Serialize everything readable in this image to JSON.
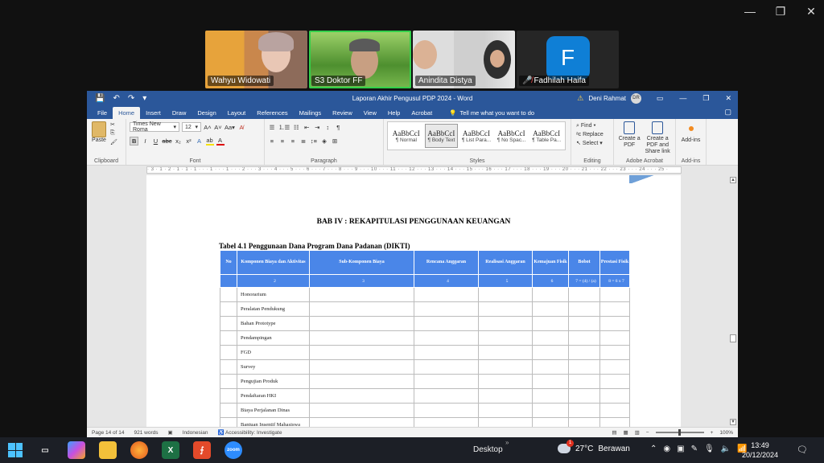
{
  "zoom_window": {
    "minimize": "—",
    "restore": "❐",
    "close": "✕"
  },
  "participants": [
    {
      "name": "Wahyu Widowati",
      "muted": false
    },
    {
      "name": "S3 Doktor FF",
      "muted": false
    },
    {
      "name": "Anindita Distya",
      "muted": false
    },
    {
      "name": "Fadhilah Haifa",
      "muted": true,
      "avatar_letter": "F"
    }
  ],
  "word": {
    "title": "Laporan Akhir Pengusul PDP 2024  -  Word",
    "user_name": "Deni Rahmat",
    "user_initials": "DR",
    "tabs": [
      "File",
      "Home",
      "Insert",
      "Draw",
      "Design",
      "Layout",
      "References",
      "Mailings",
      "Review",
      "View",
      "Help",
      "Acrobat"
    ],
    "tell_me": "Tell me what you want to do",
    "ribbon": {
      "clipboard": {
        "paste": "Paste",
        "label": "Clipboard"
      },
      "font": {
        "name": "Times New Roma",
        "size": "12",
        "label": "Font"
      },
      "paragraph": {
        "label": "Paragraph"
      },
      "styles": {
        "label": "Styles",
        "items": [
          {
            "sample": "AaBbCcI",
            "name": "¶ Normal"
          },
          {
            "sample": "AaBbCcI",
            "name": "¶ Body Text"
          },
          {
            "sample": "AaBbCcI",
            "name": "¶ List Para..."
          },
          {
            "sample": "AaBbCcI",
            "name": "¶ No Spac..."
          },
          {
            "sample": "AaBbCcI",
            "name": "¶ Table Pa..."
          }
        ]
      },
      "editing": {
        "find": "Find",
        "replace": "Replace",
        "select": "Select",
        "label": "Editing"
      },
      "acrobat": {
        "create_pdf": "Create a PDF",
        "create_share": "Create a PDF and Share link",
        "label": "Adobe Acrobat"
      },
      "addins": {
        "button": "Add-ins",
        "label": "Add-ins"
      }
    },
    "ruler_text": "· 3 · 1 · 2 · 1 · 1 · 1 · · · 1 · · · 1 · · · 2 · · · 3 · · · 4 · · · 5 · · · 6 · · · 7 · · · 8 · · · 9 · · · 10 · · · 11 · · · 12 · · · 13 · · · 14 · · · 15 · · · 16 · · · 17 · · · 18 · · · 19 · · · 20 · · · 21 · · · 22 · · · 23 · · · 24 · · · 25 ·",
    "document": {
      "heading": "BAB IV : REKAPITULASI PENGGUNAAN KEUANGAN",
      "table_caption": "Tabel 4.1 Penggunaan Dana Program Dana Padanan (DIKTI)",
      "table_headers": [
        "No",
        "Komponen Biaya dan Aktivitas",
        "Sub-Komponen Biaya",
        "Rencana Anggaran",
        "Realisasi Anggaran",
        "Kemajuan Fisik",
        "Bobot",
        "Prestasi Fisik"
      ],
      "table_numbers": [
        "",
        "2",
        "3",
        "4",
        "5",
        "6",
        "7 = (4) / (a)",
        "8 = 6 x 7"
      ],
      "table_rows": [
        "Honorarium",
        "Peralatan Pendukung",
        "Bahan Prototype",
        "Pendampingan",
        "FGD",
        "Survey",
        "Pengujian Produk",
        "Pendaftaran HKI",
        "Biaya Perjalanan Dinas",
        "Bantuan Insentif Mahasiswa"
      ]
    },
    "status": {
      "page": "Page 14 of 14",
      "words": "921 words",
      "language": "Indonesian",
      "accessibility": "Accessibility: Investigate",
      "zoom": "100%"
    }
  },
  "taskbar": {
    "desktop": "Desktop",
    "weather_temp": "27°C",
    "weather_text": "Berawan",
    "weather_badge": "1",
    "time": "13:49",
    "date": "20/12/2024"
  }
}
